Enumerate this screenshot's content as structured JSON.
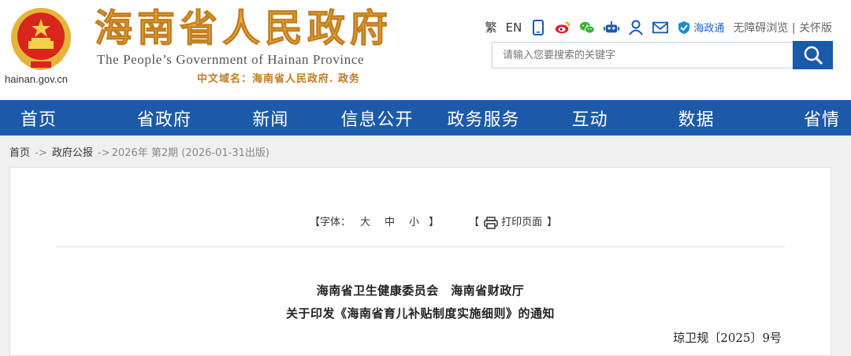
{
  "header": {
    "domain": "hainan.gov.cn",
    "site_title": "海南省人民政府",
    "site_title_en": "The People’s Government  of Hainan Province",
    "cn_domain": "中文域名：海南省人民政府. 政务"
  },
  "toolbar": {
    "traditional": "繁",
    "english": "EN",
    "icons": [
      "mobile-icon",
      "weibo-icon",
      "wechat-icon",
      "robot-icon",
      "user-icon",
      "mail-icon"
    ],
    "haizhengtong": "海政通",
    "accessibility": "无障碍浏览",
    "divider": "|",
    "elder_mode": "关怀版"
  },
  "search": {
    "placeholder": "请输入您要搜索的关键字"
  },
  "nav": {
    "items": [
      "首页",
      "省政府",
      "新闻",
      "信息公开",
      "政务服务",
      "互动",
      "数据",
      "省情"
    ]
  },
  "breadcrumb": {
    "home": "首页",
    "sep1": "->",
    "section": "政府公报",
    "sep2": "->",
    "current": "2026年 第2期 (2026-01-31出版)"
  },
  "article": {
    "font_label": "【字体：",
    "font_large": "大",
    "font_medium": "中",
    "font_small": "小",
    "font_close": "】",
    "print_open": "【",
    "print_label": "打印页面",
    "print_close": "】",
    "issuer": "海南省卫生健康委员会　海南省财政厅",
    "title": "关于印发《海南省育儿补贴制度实施细则》的通知",
    "doc_number": "琼卫规〔2025〕9号"
  },
  "colors": {
    "nav_bg": "#1b5aa8",
    "title_gold": "#e8a93a",
    "emblem_red": "#d7261c"
  }
}
